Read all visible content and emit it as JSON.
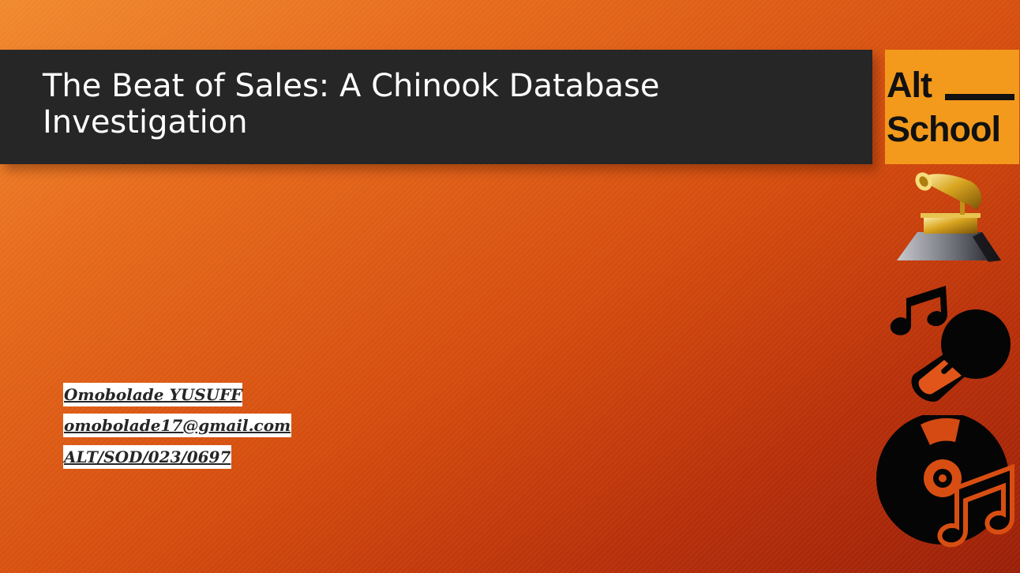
{
  "slide": {
    "title": "The Beat of Sales: A Chinook Database Investigation",
    "logo": {
      "line1": "Alt",
      "line2": "School",
      "background_color": "#f39a1c"
    },
    "author": {
      "name": "Omobolade YUSUFF",
      "email": "omobolade17@gmail.com",
      "id": "ALT/SOD/023/0697"
    },
    "icons": [
      "gramophone-award-icon",
      "music-notes-microphone-icon",
      "disc-music-notes-icon"
    ],
    "colors": {
      "title_bar": "#262626",
      "background_start": "#f08a2e",
      "background_end": "#9a1f08"
    }
  }
}
